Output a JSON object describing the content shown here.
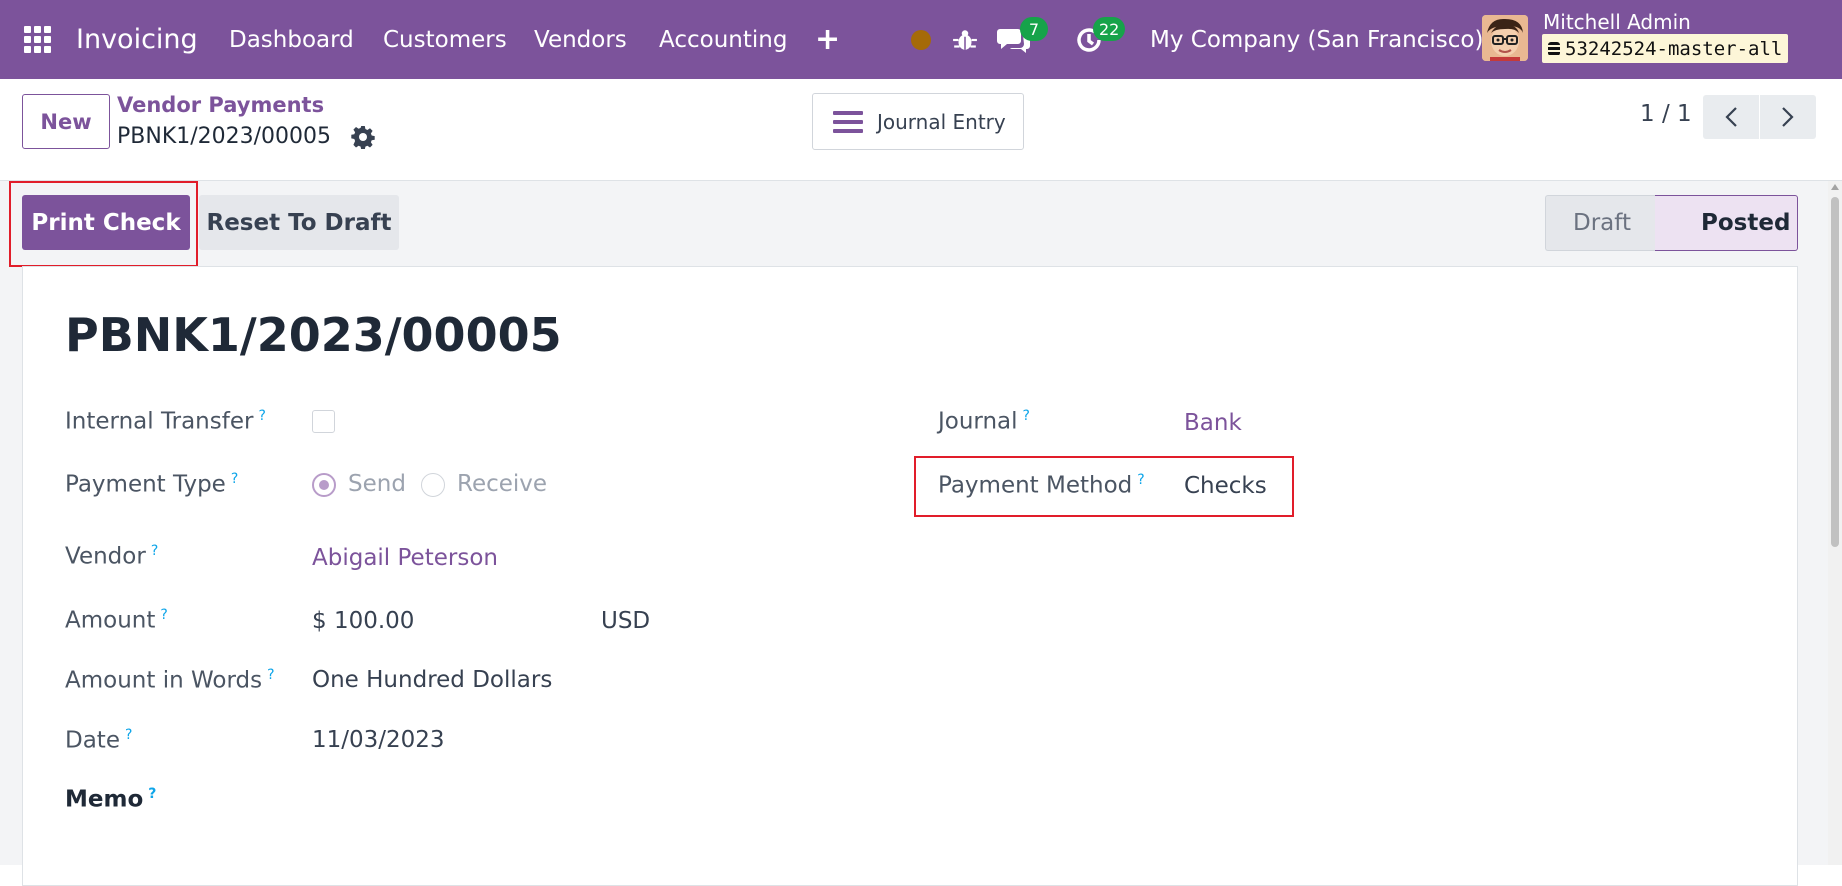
{
  "navbar": {
    "app_name": "Invoicing",
    "menu": [
      "Dashboard",
      "Customers",
      "Vendors",
      "Accounting"
    ],
    "messages_count": "7",
    "activities_count": "22",
    "company": "My Company (San Francisco)",
    "user_name": "Mitchell Admin",
    "db_name": "53242524-master-all"
  },
  "control_panel": {
    "new_label": "New",
    "breadcrumb_parent": "Vendor Payments",
    "breadcrumb_current": "PBNK1/2023/00005",
    "journal_entry_label": "Journal Entry",
    "pager": "1 / 1"
  },
  "actions": {
    "print_check": "Print Check",
    "reset_to_draft": "Reset To Draft"
  },
  "status": {
    "stages": [
      "Draft",
      "Posted"
    ],
    "current": "Posted"
  },
  "record": {
    "name": "PBNK1/2023/00005",
    "fields": {
      "internal_transfer": {
        "label": "Internal Transfer",
        "checked": false
      },
      "payment_type": {
        "label": "Payment Type",
        "options": [
          "Send",
          "Receive"
        ],
        "selected": "Send"
      },
      "vendor": {
        "label": "Vendor",
        "value": "Abigail Peterson"
      },
      "amount": {
        "label": "Amount",
        "value": "$ 100.00",
        "currency": "USD"
      },
      "amount_in_words": {
        "label": "Amount in Words",
        "value": "One Hundred Dollars"
      },
      "date": {
        "label": "Date",
        "value": "11/03/2023"
      },
      "memo": {
        "label": "Memo"
      },
      "journal": {
        "label": "Journal",
        "value": "Bank"
      },
      "payment_method": {
        "label": "Payment Method",
        "value": "Checks"
      }
    },
    "help_mark": "?"
  },
  "colors": {
    "brand": "#7c539b",
    "badge": "#16a34a",
    "highlight": "#e11d2a"
  }
}
